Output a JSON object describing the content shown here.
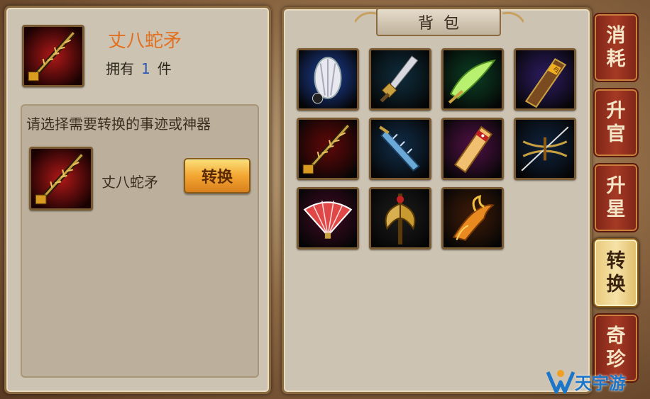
{
  "selected_item": {
    "name": "丈八蛇矛",
    "owned_label": "拥有",
    "owned_count": "1",
    "owned_unit": "件"
  },
  "convert": {
    "prompt": "请选择需要转换的事迹或神器",
    "target_name": "丈八蛇矛",
    "button_label": "转换"
  },
  "backpack": {
    "title": "背包",
    "items": [
      {
        "icon": "white-feather-fan-icon",
        "bg": "#1a3a8a"
      },
      {
        "icon": "broadsword-icon",
        "bg": "#0e2a38"
      },
      {
        "icon": "green-crescent-blade-icon",
        "bg": "#0b3a22"
      },
      {
        "icon": "command-token-icon",
        "bg": "#2a1a5a"
      },
      {
        "icon": "serpent-spear-icon",
        "bg": "#5a0808"
      },
      {
        "icon": "halberd-blade-icon",
        "bg": "#102a44"
      },
      {
        "icon": "jade-scroll-icon",
        "bg": "#4a1040"
      },
      {
        "icon": "double-crossbow-icon",
        "bg": "#0e2038"
      },
      {
        "icon": "red-folding-fan-icon",
        "bg": "#3a0a20"
      },
      {
        "icon": "golden-axe-icon",
        "bg": "#1a1a1a"
      },
      {
        "icon": "phoenix-icon",
        "bg": "#3a1a08"
      }
    ]
  },
  "tabs": [
    {
      "label": "消耗",
      "active": false
    },
    {
      "label": "升官",
      "active": false
    },
    {
      "label": "升星",
      "active": false
    },
    {
      "label": "转换",
      "active": true
    },
    {
      "label": "奇珍",
      "active": false
    }
  ],
  "watermark": {
    "text": "天宇游",
    "icon": "game-controller-logo-icon"
  },
  "colors": {
    "accent": "#e2701e",
    "count": "#2a59b5",
    "tab_red": "#a53a24",
    "tab_active": "#f6e2a8"
  }
}
